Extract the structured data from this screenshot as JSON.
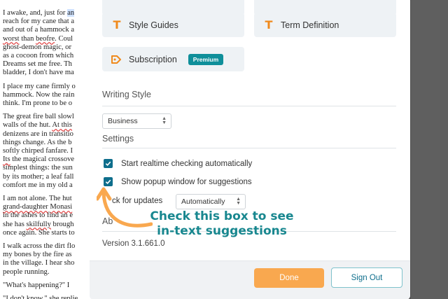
{
  "document": {
    "paragraphs": [
      [
        {
          "t": "I awake, and, just for "
        },
        {
          "t": "an",
          "hl": true
        }
      ],
      [
        {
          "t": "reach for my cane that a"
        }
      ],
      [
        {
          "t": "and out of a hammock a"
        }
      ],
      [
        {
          "t": "worst",
          "sp": true
        },
        {
          "t": " than "
        },
        {
          "t": "beofre",
          "sp": true
        },
        {
          "t": ". Coul"
        }
      ],
      [
        {
          "t": "ghost-demon magic, or "
        }
      ],
      [
        {
          "t": "as a cocoon from which"
        }
      ],
      [
        {
          "t": "Dreams set me free. Th"
        }
      ],
      [
        {
          "t": "bladder, I don't have ma"
        }
      ]
    ],
    "paragraphs2": [
      [
        {
          "t": "I place my cane firmly o"
        }
      ],
      [
        {
          "t": "hammock. Now the rain"
        }
      ],
      [
        {
          "t": "think. I'm prone to be o"
        }
      ]
    ],
    "paragraphs3": [
      [
        {
          "t": "The great fire ball slowl"
        }
      ],
      [
        {
          "t": "walls of the hut. "
        },
        {
          "t": "At this",
          "sp": true
        }
      ],
      [
        {
          "t": "denizens are in transitio"
        }
      ],
      [
        {
          "t": "things change. As the b"
        }
      ],
      [
        {
          "t": "softly chirped fanfare. I"
        }
      ],
      [
        {
          "t": "Its",
          "sp": true
        },
        {
          "t": " the magical crossove"
        }
      ],
      [
        {
          "t": "simplest things: the sun"
        }
      ],
      [
        {
          "t": "by its mother; a leaf fall"
        }
      ],
      [
        {
          "t": "comfort me in my old a"
        }
      ]
    ],
    "paragraphs4": [
      [
        {
          "t": "I am not alone. The hut"
        }
      ],
      [
        {
          "t": "grand-daughter",
          "sp": true
        },
        {
          "t": " "
        },
        {
          "t": "Monasi",
          "sp": true
        }
      ],
      [
        {
          "t": "in the ashes to find an e"
        }
      ],
      [
        {
          "t": "she has "
        },
        {
          "t": "skilfully",
          "sp": true
        },
        {
          "t": " brough"
        }
      ],
      [
        {
          "t": "once again. She starts to"
        }
      ]
    ],
    "paragraphs5": [
      [
        {
          "t": "I walk across the dirt flo"
        }
      ],
      [
        {
          "t": "my bones by the fire as"
        }
      ],
      [
        {
          "t": "in the village. I hear sho"
        }
      ],
      [
        {
          "t": "people running."
        }
      ]
    ],
    "paragraphs6": [
      [
        {
          "t": "\"What's happening?\" I "
        }
      ]
    ],
    "paragraphs7": [
      [
        {
          "t": "\"I don't know,\" she replie"
        }
      ]
    ]
  },
  "panel": {
    "cards": {
      "style_guides": "Style Guides",
      "term_definition": "Term Definition",
      "subscription": "Subscription",
      "premium_badge": "Premium"
    },
    "writing_style": {
      "title": "Writing Style",
      "selected": "Business"
    },
    "settings": {
      "title": "Settings",
      "realtime": "Start realtime checking automatically",
      "popup": "Show popup window for suggestions",
      "updates_label": "ck for updates",
      "updates_selected": "Automatically"
    },
    "about": {
      "title": "Ab",
      "version": "Version 3.1.661.0"
    },
    "footer": {
      "done": "Done",
      "sign_out": "Sign Out"
    }
  },
  "annotation": {
    "line1": "Check this box to see",
    "line2": "in-text suggestions"
  },
  "colors": {
    "accent_orange": "#f9a84f",
    "accent_teal": "#0e6e8c",
    "annotation_teal": "#18878f",
    "icon_orange": "#f08a1c"
  }
}
